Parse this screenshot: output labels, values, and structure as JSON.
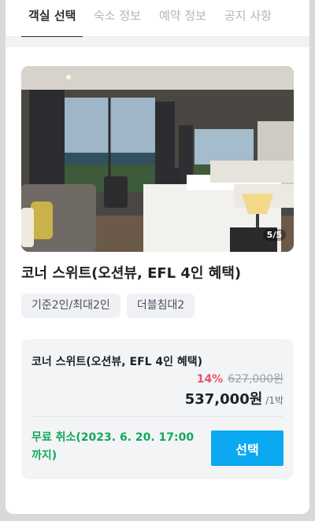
{
  "tabs": [
    {
      "label": "객실 선택",
      "active": true
    },
    {
      "label": "숙소 정보",
      "active": false
    },
    {
      "label": "예약 정보",
      "active": false
    },
    {
      "label": "공지 사항",
      "active": false
    }
  ],
  "gallery": {
    "counter": "5/5"
  },
  "room": {
    "name": "코너 스위트(오션뷰, EFL 4인 혜택)",
    "chips": [
      "기준2인/최대2인",
      "더블침대2"
    ]
  },
  "rate": {
    "name": "코너 스위트(오션뷰, EFL 4인 혜택)",
    "discount": "14%",
    "original_price": "627,000원",
    "final_price": "537,000원",
    "per_night": "/1박",
    "cancellation": "무료 취소(2023. 6. 20. 17:00까지)",
    "select_label": "선택"
  },
  "colors": {
    "accent": "#0aa9f1",
    "discount": "#e8546a",
    "free_cancel": "#13a85b"
  }
}
